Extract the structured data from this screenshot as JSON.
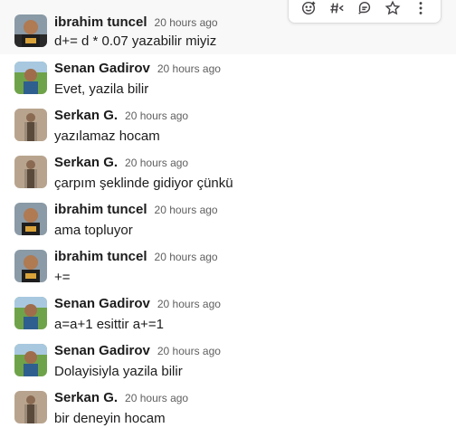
{
  "messages": [
    {
      "author": "ibrahim tuncel",
      "time": "20 hours ago",
      "text": "d+= d * 0.07 yazabilir miyiz",
      "avatar": "person-ibrahim"
    },
    {
      "author": "Senan Gadirov",
      "time": "20 hours ago",
      "text": "Evet, yazila bilir",
      "avatar": "person-senan"
    },
    {
      "author": "Serkan G.",
      "time": "20 hours ago",
      "text": "yazılamaz hocam",
      "avatar": "person-serkan"
    },
    {
      "author": "Serkan G.",
      "time": "20 hours ago",
      "text": "çarpım şeklinde gidiyor çünkü",
      "avatar": "person-serkan"
    },
    {
      "author": "ibrahim tuncel",
      "time": "20 hours ago",
      "text": "ama topluyor",
      "avatar": "person-ibrahim"
    },
    {
      "author": "ibrahim tuncel",
      "time": "20 hours ago",
      "text": "+=",
      "avatar": "person-ibrahim"
    },
    {
      "author": "Senan Gadirov",
      "time": "20 hours ago",
      "text": "a=a+1 esittir a+=1",
      "avatar": "person-senan"
    },
    {
      "author": "Senan Gadirov",
      "time": "20 hours ago",
      "text": "Dolayisiyla yazila bilir",
      "avatar": "person-senan"
    },
    {
      "author": "Serkan G.",
      "time": "20 hours ago",
      "text": "bir deneyin hocam",
      "avatar": "person-serkan"
    }
  ],
  "toolbar": {
    "icons": [
      "add-reaction-icon",
      "reply-in-channel-icon",
      "reply-in-thread-icon",
      "save-star-icon",
      "more-actions-icon"
    ]
  },
  "colors": {
    "hover_bg": "#f8f8f8",
    "text": "#1d1c1d",
    "timestamp": "#616061"
  }
}
